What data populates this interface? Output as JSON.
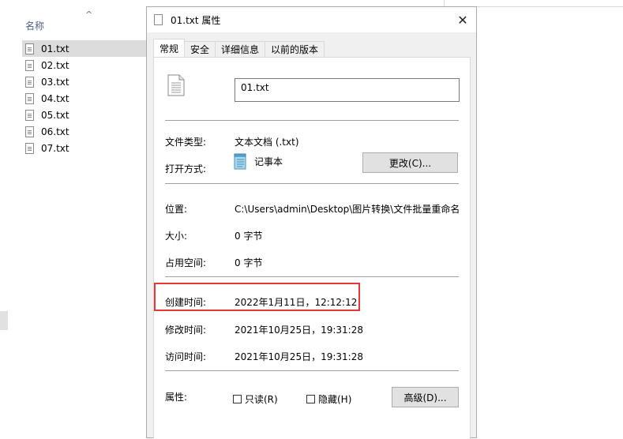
{
  "explorer": {
    "column_header": "名称",
    "sort_glyph": "^",
    "files": [
      "01.txt",
      "02.txt",
      "03.txt",
      "04.txt",
      "05.txt",
      "06.txt",
      "07.txt"
    ],
    "selected_index": 0
  },
  "dialog": {
    "title": "01.txt 属性",
    "close_glyph": "✕",
    "tabs": [
      "常规",
      "安全",
      "详细信息",
      "以前的版本"
    ],
    "active_tab": 0,
    "general": {
      "file_name": "01.txt",
      "file_type_label": "文件类型:",
      "file_type_value": "文本文档 (.txt)",
      "open_with_label": "打开方式:",
      "open_with_value": "记事本",
      "change_button": "更改(C)...",
      "location_label": "位置:",
      "location_value": "C:\\Users\\admin\\Desktop\\图片转换\\文件批量重命名",
      "size_label": "大小:",
      "size_value": "0 字节",
      "size_on_disk_label": "占用空间:",
      "size_on_disk_value": "0 字节",
      "created_label": "创建时间:",
      "created_value": "2022年1月11日，12:12:12",
      "modified_label": "修改时间:",
      "modified_value": "2021年10月25日，19:31:28",
      "accessed_label": "访问时间:",
      "accessed_value": "2021年10月25日，19:31:28",
      "attributes_label": "属性:",
      "readonly_label": "只读(R)",
      "hidden_label": "隐藏(H)",
      "advanced_button": "高级(D)..."
    }
  },
  "colors": {
    "highlight": "#e53935",
    "selection": "#dcdcdc"
  }
}
